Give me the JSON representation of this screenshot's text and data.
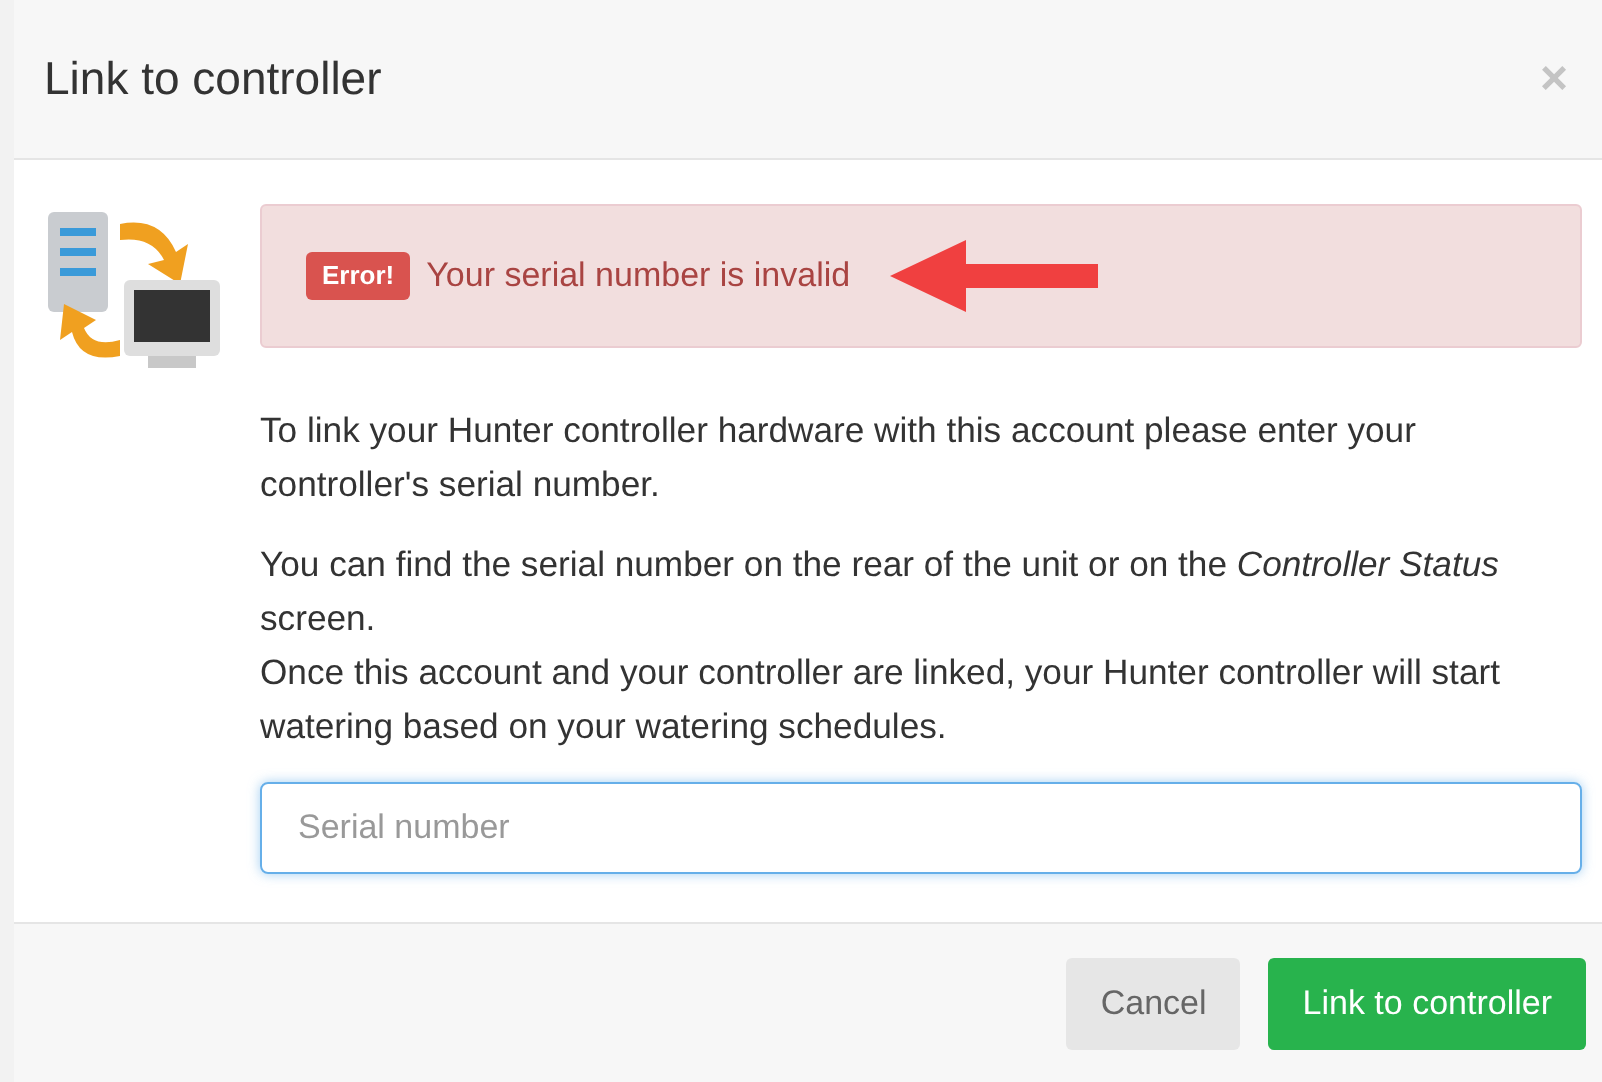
{
  "dialog": {
    "title": "Link to controller",
    "close": "×"
  },
  "alert": {
    "badge": "Error!",
    "message": "Your serial number is invalid"
  },
  "paragraphs": [
    "To link your Hunter controller hardware with this account please enter your controller's serial number.",
    "You can find the serial number on the rear of the unit or on the *Controller Status* screen.",
    "Once this account and your controller are linked, your Hunter controller will start watering based on your watering schedules."
  ],
  "serial_field": {
    "placeholder": "Serial number",
    "focused": true
  },
  "buttons": [
    {
      "label": "Cancel",
      "kind": "secondary"
    },
    {
      "label": "Link to controller",
      "kind": "primary"
    }
  ]
}
